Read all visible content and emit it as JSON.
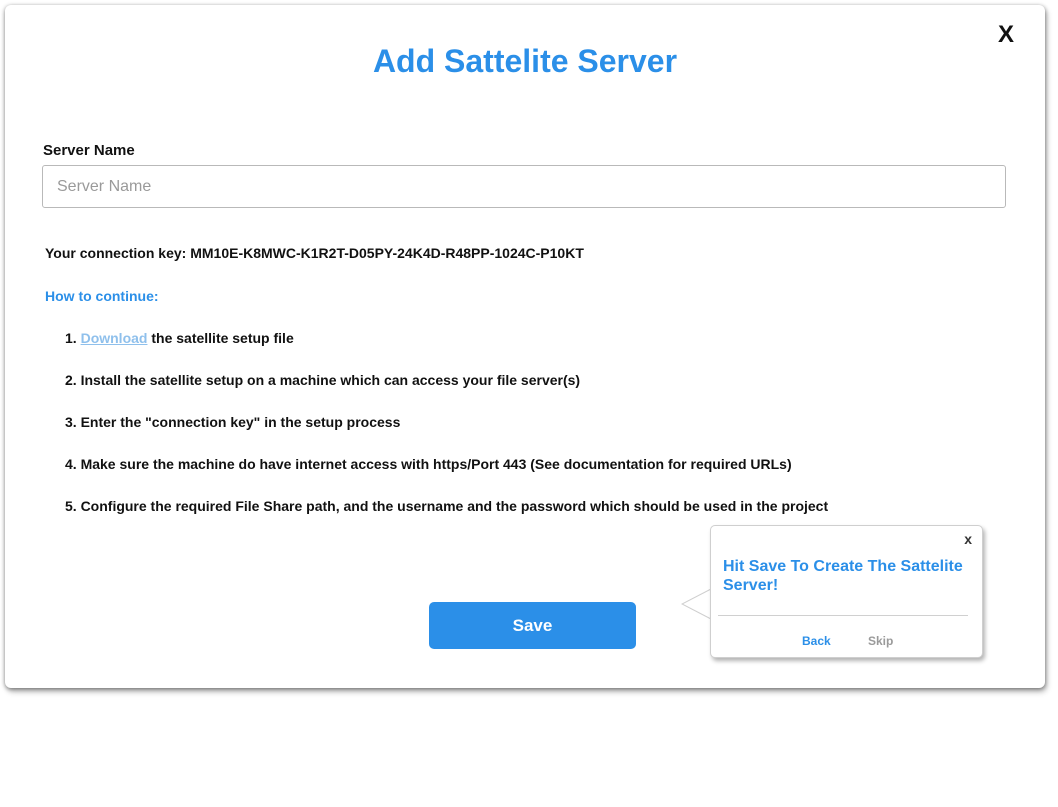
{
  "dialog": {
    "close_label": "X",
    "title": "Add Sattelite Server"
  },
  "form": {
    "server_name_label": "Server Name",
    "server_name_placeholder": "Server Name",
    "server_name_value": ""
  },
  "connection": {
    "text": "Your connection key: MM10E-K8MWC-K1R2T-D05PY-24K4D-R48PP-1024C-P10KT"
  },
  "instructions": {
    "heading": "How to continue:",
    "step1_prefix": "1. ",
    "step1_link": "Download",
    "step1_suffix": " the satellite setup file",
    "step2": "2. Install the satellite setup on a machine which can access your file server(s)",
    "step3": "3. Enter the \"connection key\" in the setup process",
    "step4": "4. Make sure the machine do have internet access with https/Port 443 (See documentation for required URLs)",
    "step5": "5. Configure the required File Share path, and the username and the password which should be used in the project"
  },
  "actions": {
    "save_label": "Save"
  },
  "tooltip": {
    "close_label": "x",
    "message": "Hit Save To Create The Sattelite Server!",
    "back_label": "Back",
    "skip_label": "Skip"
  },
  "colors": {
    "accent": "#2b8fe8",
    "link": "#8fc0ec",
    "muted": "#9a9a9a"
  }
}
